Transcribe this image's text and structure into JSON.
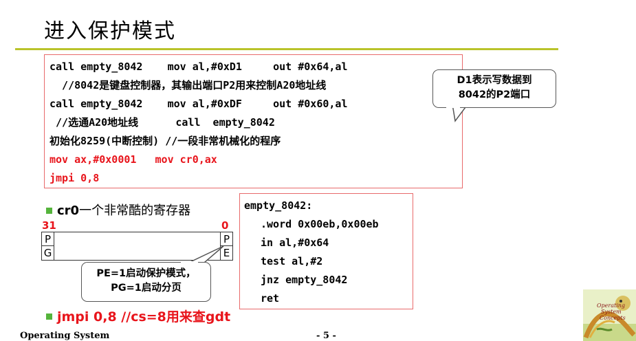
{
  "slide": {
    "title": "进入保护模式",
    "code_block": {
      "lines": [
        "call empty_8042    mov al,#0xD1     out #0x64,al",
        "  //8042是键盘控制器，其输出端口P2用来控制A20地址线",
        "call empty_8042    mov al,#0xDF     out #0x60,al",
        " //选通A20地址线      call  empty_8042",
        "初始化8259(中断控制) //一段非常机械化的程序"
      ],
      "red_lines": [
        "mov ax,#0x0001   mov cr0,ax",
        "jmpi 0,8"
      ]
    },
    "d1_callout": {
      "line1": "D1表示写数据到",
      "line2": "8042的P2端口"
    },
    "asm_block": {
      "label": "empty_8042:",
      "lines": [
        ".word 0x00eb,0x00eb",
        "in al,#0x64",
        "test al,#2",
        "jnz empty_8042",
        "ret"
      ]
    },
    "bullet1": {
      "bold": "cr0",
      "text": "一个非常酷的寄存器"
    },
    "register": {
      "bit_high": "31",
      "bit_low": "0",
      "left_top": "P",
      "left_bottom": "G",
      "right_top": "P",
      "right_bottom": "E"
    },
    "pe_callout": {
      "line1": "PE=1启动保护模式，",
      "line2": "PG=1启动分页"
    },
    "bullet2": {
      "text": "jmpi 0,8 //cs=8用来查gdt"
    },
    "footer": {
      "left": "Operating System",
      "page": "- 5 -"
    },
    "colors": {
      "accent_rule": "#b9c32a",
      "box_border": "#e8696a",
      "highlight_red": "#e8141b",
      "bullet_green": "#55b43c"
    },
    "book_cover": {
      "title_line1": "Operating",
      "title_line2": "System",
      "title_line3": "Concepts"
    }
  }
}
